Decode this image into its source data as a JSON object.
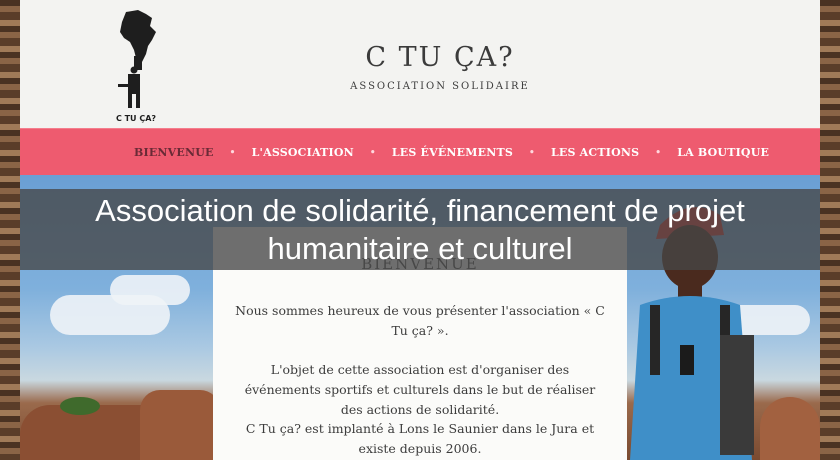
{
  "logo": {
    "text": "C TU ÇA?"
  },
  "header": {
    "title": "C TU ÇA?",
    "subtitle": "ASSOCIATION SOLIDAIRE"
  },
  "nav": {
    "items": [
      {
        "label": "BIENVENUE",
        "active": true
      },
      {
        "label": "L'ASSOCIATION",
        "active": false
      },
      {
        "label": "LES ÉVÉNEMENTS",
        "active": false
      },
      {
        "label": "LES ACTIONS",
        "active": false
      },
      {
        "label": "LA BOUTIQUE",
        "active": false
      }
    ],
    "separator": "•"
  },
  "overlay": {
    "text": "Association de solidarité, financement de projet humanitaire et culturel"
  },
  "content": {
    "title": "BIENVENUE",
    "paragraphs": [
      "Nous sommes heureux de vous présenter l'association « C Tu ça? ».",
      "L'objet de cette association est d'organiser des événements sportifs et culturels dans le but de réaliser des actions de solidarité.",
      "C Tu ça? est implanté à Lons le Saunier dans le Jura et existe depuis 2006."
    ]
  },
  "colors": {
    "nav": "#ee5b6f",
    "nav_active_text": "#6a2a36",
    "background": "#f3f3f1"
  }
}
